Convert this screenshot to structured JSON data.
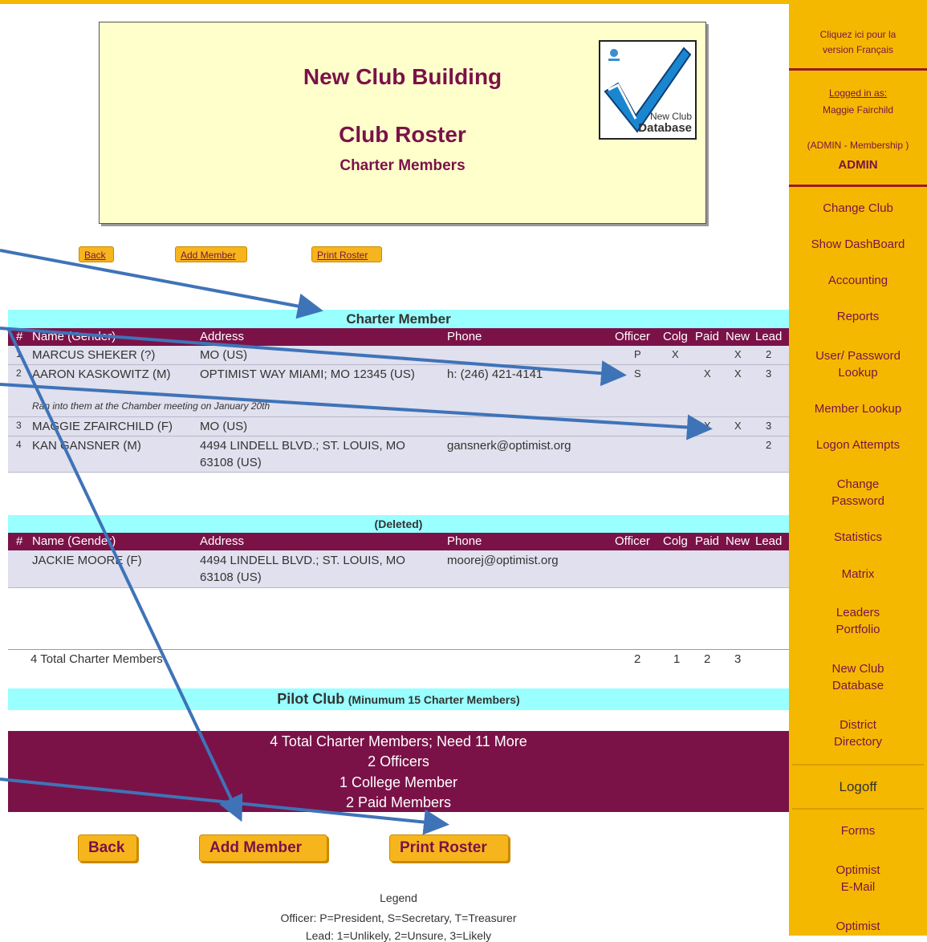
{
  "header": {
    "title": "New Club Building",
    "subtitle": "Club Roster",
    "section": "Charter Members",
    "logo": {
      "line1": "New Club",
      "line2": "Database"
    }
  },
  "top_buttons": {
    "back": "Back",
    "add_member": "Add Member",
    "print_roster": "Print Roster"
  },
  "charter_table": {
    "title": "Charter Member",
    "columns": [
      "#",
      "Name (Gender)",
      "Address",
      "Phone",
      "Officer",
      "Colg",
      "Paid",
      "New",
      "Lead"
    ],
    "rows": [
      {
        "num": "1",
        "name": "MARCUS SHEKER (?)",
        "address": "MO (US)",
        "phone": "",
        "officer": "P",
        "colg": "X",
        "paid": "",
        "new": "X",
        "lead": "2"
      },
      {
        "num": "2",
        "name": "AARON KASKOWITZ (M)",
        "address": "OPTIMIST WAY MIAMI; MO 12345 (US)",
        "phone": "h: (246) 421-4141",
        "officer": "S",
        "colg": "",
        "paid": "X",
        "new": "X",
        "lead": "3",
        "note": "Ran into them at the Chamber meeting on January 20th"
      },
      {
        "num": "3",
        "name": "MAGGIE ZFAIRCHILD (F)",
        "address": "MO (US)",
        "phone": "",
        "officer": "",
        "colg": "",
        "paid": "X",
        "new": "X",
        "lead": "3"
      },
      {
        "num": "4",
        "name": "KAN GANSNER (M)",
        "address": "4494 LINDELL BLVD.; ST. LOUIS, MO",
        "address2": "63108 (US)",
        "phone": "gansnerk@optimist.org",
        "officer": "",
        "colg": "",
        "paid": "",
        "new": "",
        "lead": "2"
      }
    ]
  },
  "deleted_table": {
    "title": "(Deleted)",
    "columns": [
      "#",
      "Name (Gender)",
      "Address",
      "Phone",
      "Officer",
      "Colg",
      "Paid",
      "New",
      "Lead"
    ],
    "rows": [
      {
        "name": "JACKIE MOORE (F)",
        "address": "4494 LINDELL BLVD.; ST. LOUIS, MO",
        "address2": "63108 (US)",
        "phone": "moorej@optimist.org"
      }
    ]
  },
  "totals": {
    "label": "4 Total Charter Members",
    "officer": "2",
    "colg": "1",
    "paid": "2",
    "new": "3"
  },
  "pilot": {
    "title": "Pilot Club",
    "subtitle": "(Minumum 15 Charter Members)"
  },
  "summary": {
    "line1": "4 Total Charter Members; Need 11 More",
    "line2": "2 Officers",
    "line3": "1 College Member",
    "line4": "2 Paid Members"
  },
  "bottom_buttons": {
    "back": "Back",
    "add_member": "Add Member",
    "print_roster": "Print Roster"
  },
  "legend": {
    "title": "Legend",
    "officer": "Officer: P=President, S=Secretary, T=Treasurer",
    "lead": "Lead: 1=Unlikely, 2=Unsure, 3=Likely"
  },
  "sidebar": {
    "french": [
      "Cliquez ici pour la",
      "version Français"
    ],
    "logged_in_label": "Logged in as:",
    "user": "Maggie Fairchild",
    "role": "(ADMIN - Membership )",
    "role2": "ADMIN",
    "items": [
      "Change Club",
      "Show DashBoard",
      "Accounting",
      "Reports",
      "User/ Password\nLookup",
      "Member Lookup",
      "Logon Attempts",
      "Change\nPassword",
      "Statistics",
      "Matrix",
      "Leaders\nPortfolio",
      "New Club\nDatabase",
      "District\nDirectory"
    ],
    "logoff": "Logoff",
    "forms": "Forms",
    "email": [
      "Optimist",
      "E-Mail"
    ],
    "optimist": "Optimist"
  },
  "colors": {
    "accent": "#7a1248",
    "sidebar": "#f5b800",
    "band": "#99ffff",
    "arrow": "#3f73b8"
  }
}
